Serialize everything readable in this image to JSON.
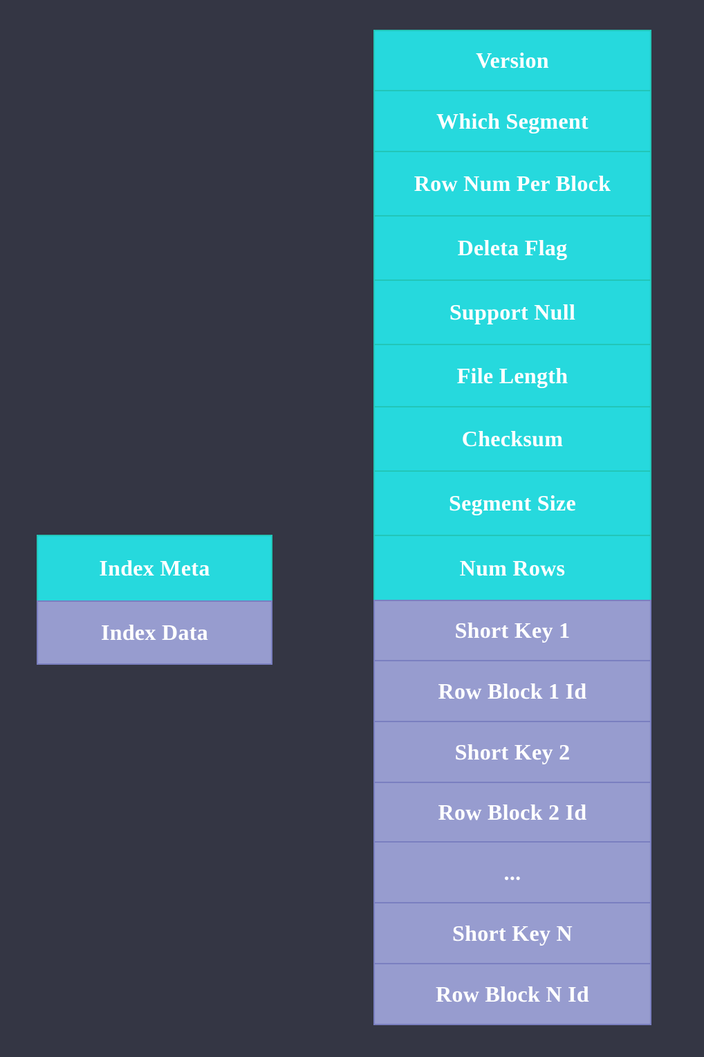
{
  "colors": {
    "background": "#343644",
    "meta": "#26d9dd",
    "data": "#979ccf"
  },
  "index_file": {
    "meta_label": "Index Meta",
    "data_label": "Index Data"
  },
  "segment_layout": {
    "meta_fields": [
      "Version",
      "Which Segment",
      "Row Num Per Block",
      "Deleta Flag",
      "Support Null",
      "File Length",
      "Checksum",
      "Segment Size",
      "Num Rows"
    ],
    "data_fields": [
      "Short Key 1",
      "Row Block 1 Id",
      "Short Key 2",
      "Row Block 2 Id",
      "...",
      "Short Key N",
      "Row Block N Id"
    ]
  }
}
